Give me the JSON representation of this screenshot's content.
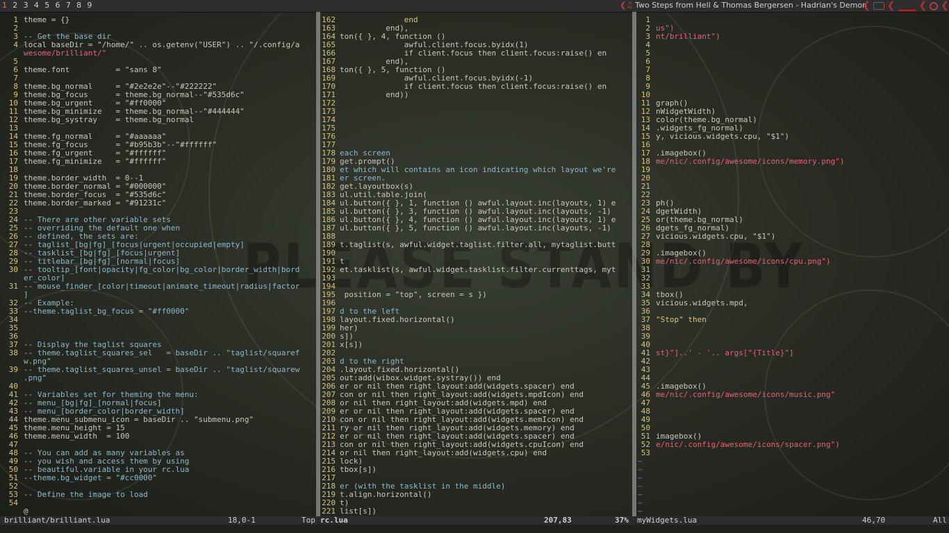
{
  "topbar": {
    "tags": [
      "1",
      "2",
      "3",
      "4",
      "5",
      "6",
      "7",
      "8",
      "9"
    ],
    "active_tag": "1",
    "now_playing": "Two Steps from Hell & Thomas Bergersen - Hadrian's Demon",
    "now_playing_icon": "music-note-icon"
  },
  "panes": [
    {
      "name": "brilliant-lua",
      "lines": [
        {
          "n": "1",
          "t": "theme = {}",
          "c": "id"
        },
        {
          "n": "2",
          "t": "",
          "c": "id"
        },
        {
          "n": "3",
          "t": "-- Get the base dir",
          "c": "cmt"
        },
        {
          "n": "4",
          "t": "local baseDir = \"/home/\" .. os.getenv(\"USER\") .. \"/.config/a",
          "c": "id"
        },
        {
          "n": "",
          "t": "wesome/brilliant/\"",
          "c": "str"
        },
        {
          "n": "5",
          "t": "",
          "c": "id"
        },
        {
          "n": "6",
          "t": "theme.font          = \"sans 8\"",
          "c": "id"
        },
        {
          "n": "7",
          "t": "",
          "c": "id"
        },
        {
          "n": "8",
          "t": "theme.bg_normal     = \"#2e2e2e\"--\"#222222\"",
          "c": "id"
        },
        {
          "n": "9",
          "t": "theme.bg_focus      = theme.bg_normal--\"#535d6c\"",
          "c": "id"
        },
        {
          "n": "10",
          "t": "theme.bg_urgent     = \"#ff0000\"",
          "c": "id"
        },
        {
          "n": "11",
          "t": "theme.bg_minimize   = theme.bg_normal--\"#444444\"",
          "c": "id"
        },
        {
          "n": "12",
          "t": "theme.bg_systray    = theme.bg_normal",
          "c": "id"
        },
        {
          "n": "13",
          "t": "",
          "c": "id"
        },
        {
          "n": "14",
          "t": "theme.fg_normal     = \"#aaaaaa\"",
          "c": "id"
        },
        {
          "n": "15",
          "t": "theme.fg_focus      = \"#b95b3b\"--\"#ffffff\"",
          "c": "id"
        },
        {
          "n": "16",
          "t": "theme.fg_urgent     = \"#ffffff\"",
          "c": "id"
        },
        {
          "n": "17",
          "t": "theme.fg_minimize   = \"#ffffff\"",
          "c": "id"
        },
        {
          "n": "18",
          "t": "",
          "c": "id"
        },
        {
          "n": "19",
          "t": "theme.border_width  = 0--1",
          "c": "id"
        },
        {
          "n": "20",
          "t": "theme.border_normal = \"#000000\"",
          "c": "id"
        },
        {
          "n": "21",
          "t": "theme.border_focus  = \"#535d6c\"",
          "c": "id"
        },
        {
          "n": "22",
          "t": "theme.border_marked = \"#91231c\"",
          "c": "id"
        },
        {
          "n": "23",
          "t": "",
          "c": "id"
        },
        {
          "n": "24",
          "t": "-- There are other variable sets",
          "c": "cmt"
        },
        {
          "n": "25",
          "t": "-- overriding the default one when",
          "c": "cmt"
        },
        {
          "n": "26",
          "t": "-- defined, the sets are:",
          "c": "cmt"
        },
        {
          "n": "27",
          "t": "-- taglist_[bg|fg]_[focus|urgent|occupied|empty]",
          "c": "cmt"
        },
        {
          "n": "28",
          "t": "-- tasklist_[bg|fg]_[focus|urgent]",
          "c": "cmt"
        },
        {
          "n": "29",
          "t": "-- titlebar_[bg|fg]_[normal|focus]",
          "c": "cmt"
        },
        {
          "n": "30",
          "t": "-- tooltip_[font|opacity|fg_color|bg_color|border_width|bord",
          "c": "cmt"
        },
        {
          "n": "",
          "t": "er_color]",
          "c": "cmt"
        },
        {
          "n": "31",
          "t": "-- mouse_finder_[color|timeout|animate_timeout|radius|factor",
          "c": "cmt"
        },
        {
          "n": "",
          "t": "]",
          "c": "cmt"
        },
        {
          "n": "32",
          "t": "-- Example:",
          "c": "cmt"
        },
        {
          "n": "33",
          "t": "--theme.taglist_bg_focus = \"#ff0000\"",
          "c": "cmt"
        },
        {
          "n": "34",
          "t": "",
          "c": "id"
        },
        {
          "n": "35",
          "t": "",
          "c": "id"
        },
        {
          "n": "36",
          "t": "",
          "c": "id"
        },
        {
          "n": "37",
          "t": "-- Display the taglist squares",
          "c": "cmt"
        },
        {
          "n": "38",
          "t": "-- theme.taglist_squares_sel   = baseDir .. \"taglist/squaref",
          "c": "cmt"
        },
        {
          "n": "",
          "t": "w.png\"",
          "c": "cmt"
        },
        {
          "n": "39",
          "t": "-- theme.taglist_squares_unsel = baseDir .. \"taglist/squarew",
          "c": "cmt"
        },
        {
          "n": "",
          "t": ".png\"",
          "c": "cmt"
        },
        {
          "n": "40",
          "t": "",
          "c": "id"
        },
        {
          "n": "41",
          "t": "-- Variables set for theming the menu:",
          "c": "cmt"
        },
        {
          "n": "42",
          "t": "-- menu_[bg|fg]_[normal|focus]",
          "c": "cmt"
        },
        {
          "n": "43",
          "t": "-- menu_[border_color|border_width]",
          "c": "cmt"
        },
        {
          "n": "44",
          "t": "theme.menu_submenu_icon = baseDir .. \"submenu.png\"",
          "c": "id"
        },
        {
          "n": "45",
          "t": "theme.menu_height = 15",
          "c": "id"
        },
        {
          "n": "46",
          "t": "theme.menu_width  = 100",
          "c": "id"
        },
        {
          "n": "47",
          "t": "",
          "c": "id"
        },
        {
          "n": "48",
          "t": "-- You can add as many variables as",
          "c": "cmt"
        },
        {
          "n": "49",
          "t": "-- you wish and access them by using",
          "c": "cmt"
        },
        {
          "n": "50",
          "t": "-- beautiful.variable in your rc.lua",
          "c": "cmt"
        },
        {
          "n": "51",
          "t": "--theme.bg_widget = \"#cc0000\"",
          "c": "cmt"
        },
        {
          "n": "52",
          "t": "",
          "c": "id"
        },
        {
          "n": "53",
          "t": "-- Define the image to load",
          "c": "cmt"
        },
        {
          "n": "54",
          "t": "",
          "c": "id"
        },
        {
          "n": "",
          "t": "@",
          "c": "id",
          "tilde": false
        }
      ]
    },
    {
      "name": "rc-lua",
      "lines": [
        {
          "n": "162",
          "t": "              end",
          "c": "kw"
        },
        {
          "n": "163",
          "t": "          end),",
          "c": "id"
        },
        {
          "n": "164",
          "t": "ton({ }, 4, function ()",
          "c": "id"
        },
        {
          "n": "165",
          "t": "              awful.client.focus.byidx(1)",
          "c": "id"
        },
        {
          "n": "166",
          "t": "              if client.focus then client.focus:raise() en",
          "c": "id"
        },
        {
          "n": "167",
          "t": "          end),",
          "c": "id"
        },
        {
          "n": "168",
          "t": "ton({ }, 5, function ()",
          "c": "id"
        },
        {
          "n": "169",
          "t": "              awful.client.focus.byidx(-1)",
          "c": "id"
        },
        {
          "n": "170",
          "t": "              if client.focus then client.focus:raise() en",
          "c": "id"
        },
        {
          "n": "171",
          "t": "          end))",
          "c": "id"
        },
        {
          "n": "172",
          "t": "",
          "c": "id"
        },
        {
          "n": "173",
          "t": "",
          "c": "id"
        },
        {
          "n": "174",
          "t": "",
          "c": "id"
        },
        {
          "n": "175",
          "t": "",
          "c": "id"
        },
        {
          "n": "176",
          "t": "",
          "c": "id"
        },
        {
          "n": "177",
          "t": "",
          "c": "id"
        },
        {
          "n": "178",
          "t": "each screen",
          "c": "cmt"
        },
        {
          "n": "179",
          "t": "get.prompt()",
          "c": "id"
        },
        {
          "n": "180",
          "t": "et which will contains an icon indicating which layout we're",
          "c": "cmt"
        },
        {
          "n": "181",
          "t": "er screen.",
          "c": "cmt"
        },
        {
          "n": "182",
          "t": "get.layoutbox(s)",
          "c": "id"
        },
        {
          "n": "183",
          "t": "ul.util.table.join(",
          "c": "id"
        },
        {
          "n": "184",
          "t": "ul.button({ }, 1, function () awful.layout.inc(layouts, 1) e",
          "c": "id"
        },
        {
          "n": "185",
          "t": "ul.button({ }, 3, function () awful.layout.inc(layouts, -1) ",
          "c": "id"
        },
        {
          "n": "186",
          "t": "ul.button({ }, 4, function () awful.layout.inc(layouts, 1) e",
          "c": "id"
        },
        {
          "n": "187",
          "t": "ul.button({ }, 5, function () awful.layout.inc(layouts, -1) ",
          "c": "id"
        },
        {
          "n": "188",
          "t": "",
          "c": "id"
        },
        {
          "n": "189",
          "t": "t.taglist(s, awful.widget.taglist.filter.all, mytaglist.butt",
          "c": "id"
        },
        {
          "n": "190",
          "t": "",
          "c": "id"
        },
        {
          "n": "191",
          "t": "t",
          "c": "id"
        },
        {
          "n": "192",
          "t": "et.tasklist(s, awful.widget.tasklist.filter.currenttags, myt",
          "c": "id"
        },
        {
          "n": "193",
          "t": "",
          "c": "id"
        },
        {
          "n": "194",
          "t": "",
          "c": "id"
        },
        {
          "n": "195",
          "t": " position = \"top\", screen = s })",
          "c": "id"
        },
        {
          "n": "196",
          "t": "",
          "c": "id"
        },
        {
          "n": "197",
          "t": "d to the left",
          "c": "cmt"
        },
        {
          "n": "198",
          "t": "layout.fixed.horizontal()",
          "c": "id"
        },
        {
          "n": "199",
          "t": "her)",
          "c": "id"
        },
        {
          "n": "200",
          "t": "s])",
          "c": "id"
        },
        {
          "n": "201",
          "t": "x[s])",
          "c": "id"
        },
        {
          "n": "202",
          "t": "",
          "c": "id"
        },
        {
          "n": "203",
          "t": "d to the right",
          "c": "cmt"
        },
        {
          "n": "204",
          "t": ".layout.fixed.horizontal()",
          "c": "id"
        },
        {
          "n": "205",
          "t": "out:add(wibox.widget.systray()) end",
          "c": "id"
        },
        {
          "n": "206",
          "t": "er or nil then right_layout:add(widgets.spacer) end",
          "c": "id"
        },
        {
          "n": "207",
          "t": "con or nil then right_layout:add(widgets.mpdIcon) end",
          "c": "id"
        },
        {
          "n": "208",
          "t": "or nil then right_layout:add(widgets.mpd) end",
          "c": "id"
        },
        {
          "n": "209",
          "t": "er or nil then right_layout:add(widgets.spacer) end",
          "c": "id"
        },
        {
          "n": "210",
          "t": "con or nil then right_layout:add(widgets.memIcon) end",
          "c": "id"
        },
        {
          "n": "211",
          "t": "ry or nil then right_layout:add(widgets.memory) end",
          "c": "id"
        },
        {
          "n": "212",
          "t": "er or nil then right_layout:add(widgets.spacer) end",
          "c": "id"
        },
        {
          "n": "213",
          "t": "con or nil then right_layout:add(widgets.cpuIcon) end",
          "c": "id"
        },
        {
          "n": "214",
          "t": "or nil then right_layout:add(widgets.cpu) end",
          "c": "id"
        },
        {
          "n": "215",
          "t": "lock)",
          "c": "id"
        },
        {
          "n": "216",
          "t": "tbox[s])",
          "c": "id"
        },
        {
          "n": "217",
          "t": "",
          "c": "id"
        },
        {
          "n": "218",
          "t": "er (with the tasklist in the middle)",
          "c": "cmt"
        },
        {
          "n": "219",
          "t": "t.align.horizontal()",
          "c": "id"
        },
        {
          "n": "220",
          "t": "t)",
          "c": "id"
        },
        {
          "n": "221",
          "t": "list[s])",
          "c": "id"
        }
      ]
    },
    {
      "name": "mywidgets-lua",
      "lines": [
        {
          "n": "1",
          "t": "",
          "c": "id"
        },
        {
          "n": "2",
          "t": "us\")",
          "c": "str"
        },
        {
          "n": "3",
          "t": "nt/brilliant\")",
          "c": "str"
        },
        {
          "n": "4",
          "t": "",
          "c": "id"
        },
        {
          "n": "5",
          "t": "",
          "c": "id"
        },
        {
          "n": "6",
          "t": "",
          "c": "id"
        },
        {
          "n": "7",
          "t": "",
          "c": "id"
        },
        {
          "n": "8",
          "t": "",
          "c": "id"
        },
        {
          "n": "9",
          "t": "",
          "c": "id"
        },
        {
          "n": "10",
          "t": "",
          "c": "id"
        },
        {
          "n": "11",
          "t": "graph()",
          "c": "id"
        },
        {
          "n": "12",
          "t": "nWidgetWidth)",
          "c": "id"
        },
        {
          "n": "13",
          "t": "color(theme.bg_normal)",
          "c": "id"
        },
        {
          "n": "14",
          "t": ".widgets_fg_normal)",
          "c": "id"
        },
        {
          "n": "15",
          "t": "y, vicious.widgets.cpu, \"$1\")",
          "c": "id"
        },
        {
          "n": "16",
          "t": "",
          "c": "id"
        },
        {
          "n": "17",
          "t": ".imagebox()",
          "c": "id"
        },
        {
          "n": "18",
          "t": "me/nic/.config/awesome/icons/memory.png\")",
          "c": "str"
        },
        {
          "n": "19",
          "t": "",
          "c": "id"
        },
        {
          "n": "20",
          "t": "",
          "c": "id"
        },
        {
          "n": "21",
          "t": "",
          "c": "id"
        },
        {
          "n": "22",
          "t": "",
          "c": "id"
        },
        {
          "n": "23",
          "t": "ph()",
          "c": "id"
        },
        {
          "n": "24",
          "t": "dgetWidth)",
          "c": "id"
        },
        {
          "n": "25",
          "t": "or(theme.bg_normal)",
          "c": "id"
        },
        {
          "n": "26",
          "t": "dgets_fg_normal)",
          "c": "id"
        },
        {
          "n": "27",
          "t": "vicious.widgets.cpu, \"$1\")",
          "c": "id"
        },
        {
          "n": "28",
          "t": "",
          "c": "id"
        },
        {
          "n": "29",
          "t": ".imagebox()",
          "c": "id"
        },
        {
          "n": "30",
          "t": "me/nic/.config/awesome/icons/cpu.png\")",
          "c": "str"
        },
        {
          "n": "31",
          "t": "",
          "c": "id"
        },
        {
          "n": "32",
          "t": "",
          "c": "id"
        },
        {
          "n": "33",
          "t": "",
          "c": "id"
        },
        {
          "n": "34",
          "t": "tbox()",
          "c": "id"
        },
        {
          "n": "35",
          "t": "vicious.widgets.mpd,",
          "c": "id"
        },
        {
          "n": "36",
          "t": "",
          "c": "id"
        },
        {
          "n": "37",
          "t": "\"Stop\" then",
          "c": "kw"
        },
        {
          "n": "38",
          "t": "",
          "c": "id"
        },
        {
          "n": "39",
          "t": "",
          "c": "id"
        },
        {
          "n": "40",
          "t": "",
          "c": "id"
        },
        {
          "n": "41",
          "t": "st}\"]..' - '.. args[\"{Title}\"]",
          "c": "str"
        },
        {
          "n": "42",
          "t": "",
          "c": "id"
        },
        {
          "n": "43",
          "t": "",
          "c": "id"
        },
        {
          "n": "44",
          "t": "",
          "c": "id"
        },
        {
          "n": "45",
          "t": ".imagebox()",
          "c": "id"
        },
        {
          "n": "46",
          "t": "me/nic/.config/awesome/icons/music.png\"",
          "c": "str"
        },
        {
          "n": "47",
          "t": "",
          "c": "id"
        },
        {
          "n": "48",
          "t": "",
          "c": "id"
        },
        {
          "n": "49",
          "t": "",
          "c": "id"
        },
        {
          "n": "50",
          "t": "",
          "c": "id"
        },
        {
          "n": "51",
          "t": "imagebox()",
          "c": "id"
        },
        {
          "n": "52",
          "t": "e/nic/.config/awesome/icons/spacer.png\")",
          "c": "str"
        },
        {
          "n": "53",
          "t": "",
          "c": "id"
        },
        {
          "n": "",
          "t": "~",
          "c": "id",
          "tilde": true
        },
        {
          "n": "",
          "t": "~",
          "c": "id",
          "tilde": true
        },
        {
          "n": "",
          "t": "~",
          "c": "id",
          "tilde": true
        },
        {
          "n": "",
          "t": "~",
          "c": "id",
          "tilde": true
        },
        {
          "n": "",
          "t": "~",
          "c": "id",
          "tilde": true
        },
        {
          "n": "",
          "t": "~",
          "c": "id",
          "tilde": true
        },
        {
          "n": "",
          "t": "~",
          "c": "id",
          "tilde": true
        }
      ]
    }
  ],
  "status": [
    {
      "file": "brilliant/brilliant.lua",
      "pos": "18,0-1",
      "pct": "Top"
    },
    {
      "file": "rc.lua",
      "pos": "207,83",
      "pct": "37%"
    },
    {
      "file": "myWidgets.lua",
      "pos": "46,70",
      "pct": "All"
    }
  ],
  "colors": {
    "line_number": "#d8c47a",
    "comment": "#8fb8c8",
    "string": "#e8607a",
    "keyword": "#d8c47a",
    "active_tag": "#e07a6a",
    "accent_red": "#e01010"
  }
}
